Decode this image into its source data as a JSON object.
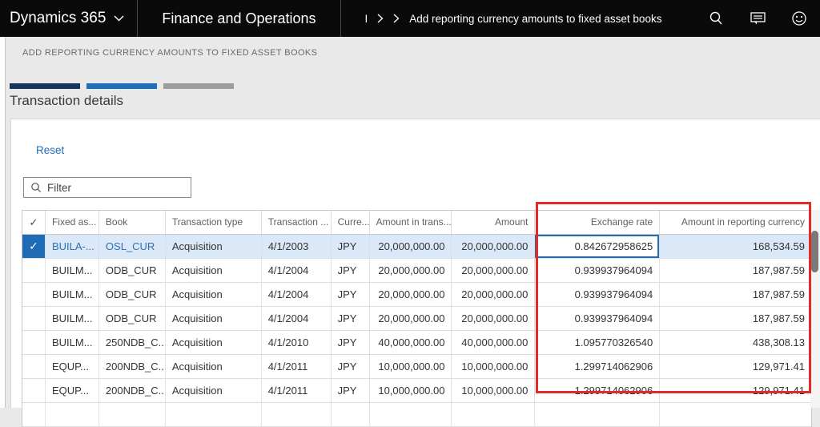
{
  "topbar": {
    "app_name": "Dynamics 365",
    "module_name": "Finance and Operations",
    "breadcrumb_root": "I",
    "breadcrumb_page": "Add reporting currency amounts to fixed asset books",
    "icons": [
      "search-icon",
      "feedback-message-icon",
      "smiley-icon"
    ]
  },
  "page": {
    "caption": "ADD REPORTING CURRENCY AMOUNTS TO FIXED ASSET BOOKS",
    "section_title": "Transaction details",
    "reset_label": "Reset",
    "filter_placeholder": "Filter"
  },
  "progress": {
    "segments": [
      {
        "name": "step-done",
        "color": "#17365d",
        "width": 88
      },
      {
        "name": "step-current",
        "color": "#1d70b8",
        "width": 88
      },
      {
        "name": "step-todo",
        "color": "#9d9d9d",
        "width": 88
      }
    ]
  },
  "table": {
    "columns": [
      {
        "key": "sel",
        "label": "✓",
        "width": 29,
        "align": "center"
      },
      {
        "key": "fixed_asset",
        "label": "Fixed as...",
        "width": 67,
        "align": "left"
      },
      {
        "key": "book",
        "label": "Book",
        "width": 83,
        "align": "left"
      },
      {
        "key": "transaction_type",
        "label": "Transaction type",
        "width": 120,
        "align": "left"
      },
      {
        "key": "transaction_date",
        "label": "Transaction ...",
        "width": 87,
        "align": "left"
      },
      {
        "key": "currency",
        "label": "Curre...",
        "width": 48,
        "align": "left"
      },
      {
        "key": "amount_in_trans",
        "label": "Amount in trans...",
        "width": 103,
        "align": "right",
        "header_align": "left"
      },
      {
        "key": "amount",
        "label": "Amount",
        "width": 104,
        "align": "right"
      },
      {
        "key": "exchange_rate",
        "label": "Exchange rate",
        "width": 156,
        "align": "right"
      },
      {
        "key": "amount_reporting",
        "label": "Amount in reporting currency",
        "width": 189,
        "align": "right"
      }
    ],
    "rows": [
      {
        "sel": true,
        "fixed_asset": "BUILA-...",
        "book": "OSL_CUR",
        "transaction_type": "Acquisition",
        "transaction_date": "4/1/2003",
        "currency": "JPY",
        "amount_in_trans": "20,000,000.00",
        "amount": "20,000,000.00",
        "exchange_rate": "0.842672958625",
        "amount_reporting": "168,534.59"
      },
      {
        "sel": false,
        "fixed_asset": "BUILM...",
        "book": "ODB_CUR",
        "transaction_type": "Acquisition",
        "transaction_date": "4/1/2004",
        "currency": "JPY",
        "amount_in_trans": "20,000,000.00",
        "amount": "20,000,000.00",
        "exchange_rate": "0.939937964094",
        "amount_reporting": "187,987.59"
      },
      {
        "sel": false,
        "fixed_asset": "BUILM...",
        "book": "ODB_CUR",
        "transaction_type": "Acquisition",
        "transaction_date": "4/1/2004",
        "currency": "JPY",
        "amount_in_trans": "20,000,000.00",
        "amount": "20,000,000.00",
        "exchange_rate": "0.939937964094",
        "amount_reporting": "187,987.59"
      },
      {
        "sel": false,
        "fixed_asset": "BUILM...",
        "book": "ODB_CUR",
        "transaction_type": "Acquisition",
        "transaction_date": "4/1/2004",
        "currency": "JPY",
        "amount_in_trans": "20,000,000.00",
        "amount": "20,000,000.00",
        "exchange_rate": "0.939937964094",
        "amount_reporting": "187,987.59"
      },
      {
        "sel": false,
        "fixed_asset": "BUILM...",
        "book": "250NDB_C...",
        "transaction_type": "Acquisition",
        "transaction_date": "4/1/2010",
        "currency": "JPY",
        "amount_in_trans": "40,000,000.00",
        "amount": "40,000,000.00",
        "exchange_rate": "1.095770326540",
        "amount_reporting": "438,308.13"
      },
      {
        "sel": false,
        "fixed_asset": "EQUP...",
        "book": "200NDB_C...",
        "transaction_type": "Acquisition",
        "transaction_date": "4/1/2011",
        "currency": "JPY",
        "amount_in_trans": "10,000,000.00",
        "amount": "10,000,000.00",
        "exchange_rate": "1.299714062906",
        "amount_reporting": "129,971.41"
      },
      {
        "sel": false,
        "fixed_asset": "EQUP...",
        "book": "200NDB_C...",
        "transaction_type": "Acquisition",
        "transaction_date": "4/1/2011",
        "currency": "JPY",
        "amount_in_trans": "10,000,000.00",
        "amount": "10,000,000.00",
        "exchange_rate": "1.299714062906",
        "amount_reporting": "129,971.41"
      }
    ],
    "focused_cell": {
      "row": 0,
      "col": "exchange_rate"
    }
  },
  "colors": {
    "topbar_bg": "#0a0a0a",
    "accent_blue": "#1f6cb5",
    "selected_row_bg": "#dbe8f7",
    "selected_check_bg": "#1f6bb5",
    "focus_border": "#2b6cb0",
    "annotation_red": "#e32a26"
  }
}
